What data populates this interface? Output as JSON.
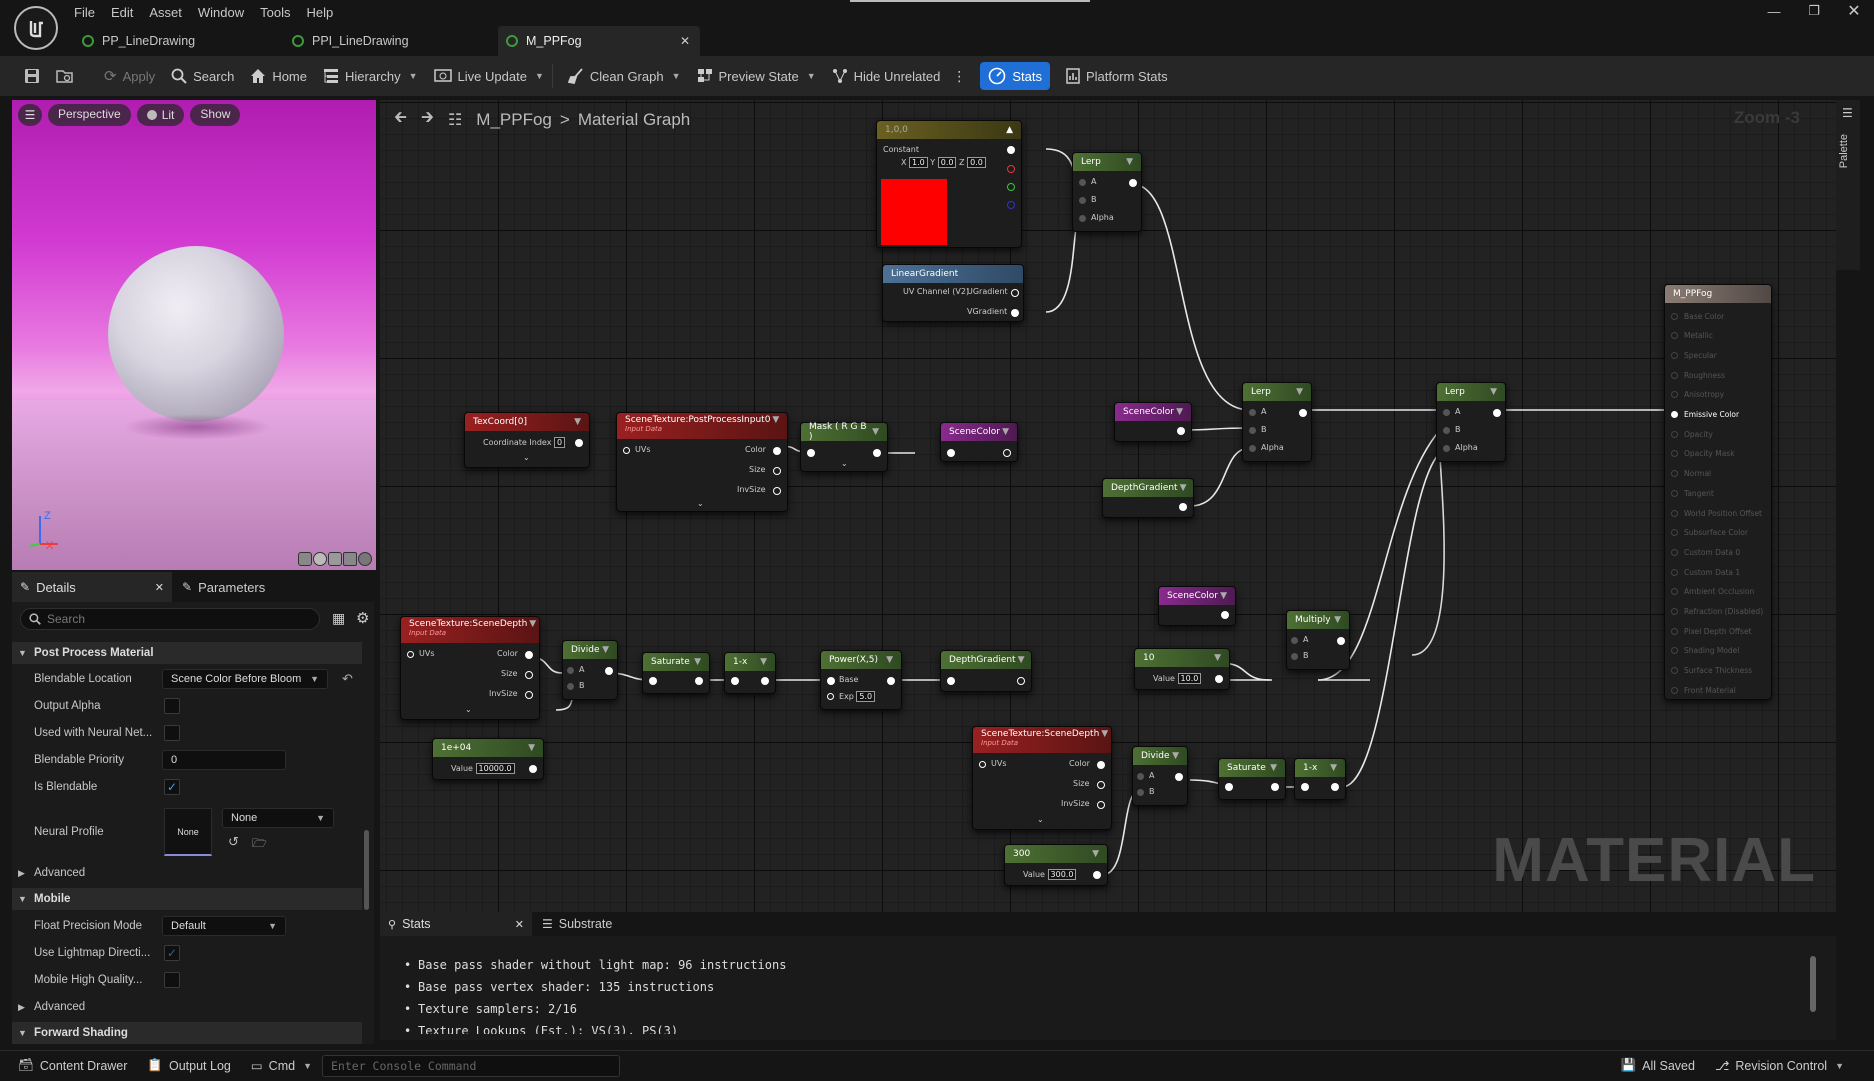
{
  "menu": [
    "File",
    "Edit",
    "Asset",
    "Window",
    "Tools",
    "Help"
  ],
  "tabs": [
    {
      "label": "PP_LineDrawing"
    },
    {
      "label": "PPI_LineDrawing"
    },
    {
      "label": "M_PPFog"
    }
  ],
  "toolbar": {
    "apply": "Apply",
    "search": "Search",
    "home": "Home",
    "hierarchy": "Hierarchy",
    "live_update": "Live Update",
    "clean_graph": "Clean Graph",
    "preview_state": "Preview State",
    "hide_unrelated": "Hide Unrelated",
    "stats": "Stats",
    "platform_stats": "Platform Stats"
  },
  "viewport": {
    "perspective": "Perspective",
    "lit": "Lit",
    "show": "Show",
    "axis_z": "Z",
    "axis_x": "X"
  },
  "details": {
    "tab_details": "Details",
    "tab_parameters": "Parameters",
    "search_placeholder": "Search",
    "sections": {
      "ppm": "Post Process Material",
      "advanced1": "Advanced",
      "mobile": "Mobile",
      "advanced2": "Advanced",
      "forward": "Forward Shading"
    },
    "rows": {
      "blendable_location": "Blendable Location",
      "blendable_location_val": "Scene Color Before Bloom",
      "output_alpha": "Output Alpha",
      "neural_net": "Used with Neural Net...",
      "blendable_priority": "Blendable Priority",
      "blendable_priority_val": "0",
      "is_blendable": "Is Blendable",
      "neural_profile": "Neural Profile",
      "neural_thumb": "None",
      "neural_select": "None",
      "float_precision": "Float Precision Mode",
      "float_precision_val": "Default",
      "lightmap_dir": "Use Lightmap Directi...",
      "mobile_hq": "Mobile High Quality..."
    }
  },
  "graph": {
    "breadcrumb_asset": "M_PPFog",
    "breadcrumb_sep": ">",
    "breadcrumb_graph": "Material Graph",
    "zoom": "Zoom -3",
    "palette": "Palette",
    "watermark": "MATERIAL",
    "nodes": {
      "constant": {
        "title": "1,0,0",
        "label": "Constant",
        "x": "1.0",
        "y": "0.0",
        "z": "0.0"
      },
      "lineargradient": {
        "title": "LinearGradient",
        "uv": "UV Channel (V2)",
        "ug": "UGradient",
        "vg": "VGradient"
      },
      "lerp1": {
        "title": "Lerp",
        "a": "A",
        "b": "B",
        "alpha": "Alpha"
      },
      "lerp2": {
        "title": "Lerp",
        "a": "A",
        "b": "B",
        "alpha": "Alpha"
      },
      "lerp3": {
        "title": "Lerp",
        "a": "A",
        "b": "B",
        "alpha": "Alpha"
      },
      "scenecolor1": {
        "title": "SceneColor"
      },
      "scenecolor2": {
        "title": "SceneColor"
      },
      "scenecolor3": {
        "title": "SceneColor"
      },
      "depthgradient1": {
        "title": "DepthGradient"
      },
      "depthgradient2": {
        "title": "DepthGradient"
      },
      "texcoord": {
        "title": "TexCoord[0]",
        "ci": "Coordinate Index",
        "ci_val": "0"
      },
      "stpp": {
        "title": "SceneTexture:PostProcessInput0",
        "sub": "Input Data",
        "uvs": "UVs",
        "color": "Color",
        "size": "Size",
        "invsize": "InvSize"
      },
      "mask": {
        "title": "Mask ( R G B )"
      },
      "std1": {
        "title": "SceneTexture:SceneDepth",
        "sub": "Input Data",
        "uvs": "UVs",
        "color": "Color",
        "size": "Size",
        "invsize": "InvSize"
      },
      "divide1": {
        "title": "Divide",
        "a": "A",
        "b": "B"
      },
      "saturate1": {
        "title": "Saturate"
      },
      "oneminus1": {
        "title": "1-x"
      },
      "power": {
        "title": "Power(X,5)",
        "base": "Base",
        "exp": "Exp",
        "exp_val": "5.0"
      },
      "c1e4": {
        "title": "1e+04",
        "value": "Value",
        "val": "10000.0"
      },
      "c10": {
        "title": "10",
        "value": "Value",
        "val": "10.0"
      },
      "multiply": {
        "title": "Multiply",
        "a": "A",
        "b": "B"
      },
      "std2": {
        "title": "SceneTexture:SceneDepth",
        "sub": "Input Data",
        "uvs": "UVs",
        "color": "Color",
        "size": "Size",
        "invsize": "InvSize"
      },
      "divide2": {
        "title": "Divide",
        "a": "A",
        "b": "B"
      },
      "saturate2": {
        "title": "Saturate"
      },
      "oneminus2": {
        "title": "1-x"
      },
      "c300": {
        "title": "300",
        "value": "Value",
        "val": "300.0"
      },
      "result": {
        "title": "M_PPFog",
        "pins": [
          "Base Color",
          "Metallic",
          "Specular",
          "Roughness",
          "Anisotropy",
          "Emissive Color",
          "Opacity",
          "Opacity Mask",
          "Normal",
          "Tangent",
          "World Position Offset",
          "Subsurface Color",
          "Custom Data 0",
          "Custom Data 1",
          "Ambient Occlusion",
          "Refraction (Disabled)",
          "Pixel Depth Offset",
          "Shading Model",
          "Surface Thickness",
          "Front Material"
        ]
      }
    }
  },
  "stats": {
    "tab_stats": "Stats",
    "tab_substrate": "Substrate",
    "lines": [
      "Base pass shader without light map: 96 instructions",
      "Base pass vertex shader: 135 instructions",
      "Texture samplers: 2/16",
      "Texture Lookups (Est.): VS(3), PS(3)"
    ]
  },
  "statusbar": {
    "content_drawer": "Content Drawer",
    "output_log": "Output Log",
    "cmd": "Cmd",
    "console_placeholder": "Enter Console Command",
    "all_saved": "All Saved",
    "revision_control": "Revision Control"
  },
  "colors": {
    "accent": "#1f6fd6",
    "constant_red": "#ff0000",
    "viewport_magenta": "#c81fc8"
  }
}
